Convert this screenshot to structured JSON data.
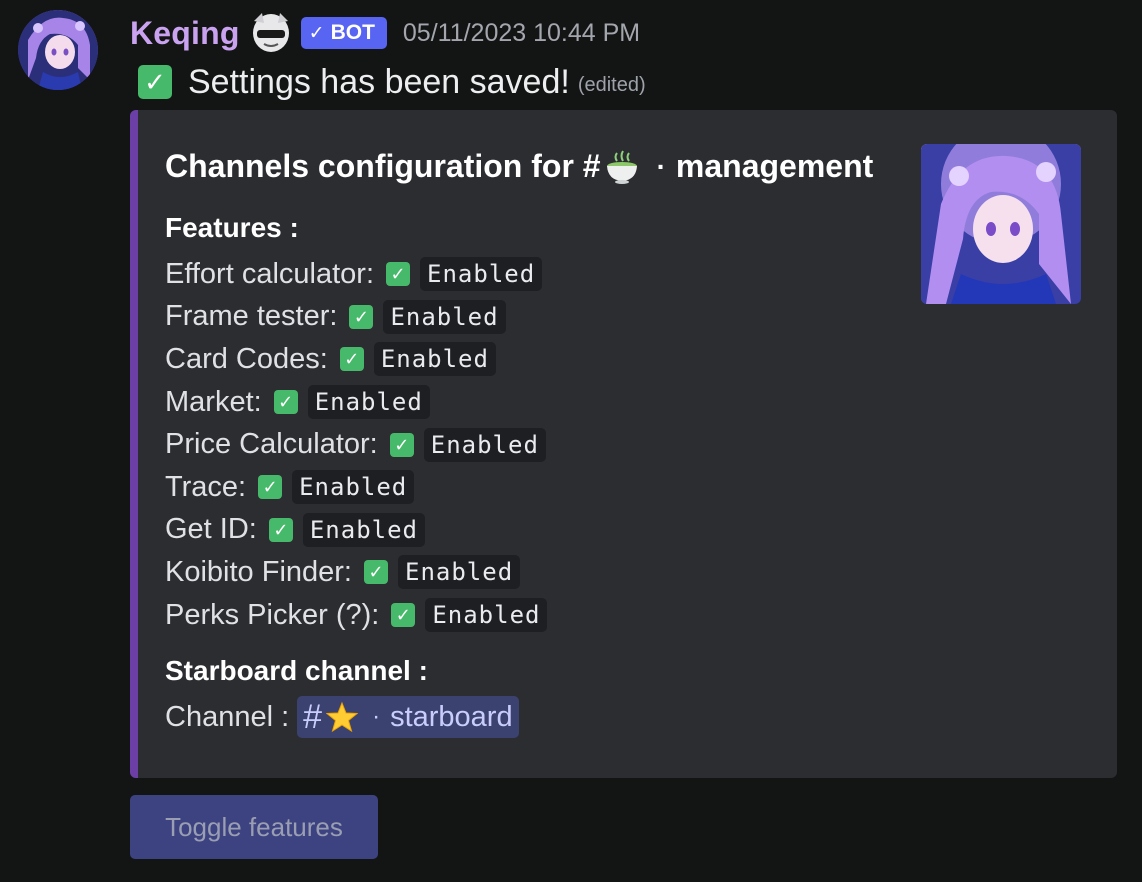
{
  "message": {
    "author": "Keqing",
    "bot_tag": "BOT",
    "bot_tag_icon": "checkmark-icon",
    "timestamp": "05/11/2023 10:44 PM",
    "content_text": "Settings has been saved!",
    "edited_label": "(edited)"
  },
  "embed": {
    "accent_color": "#6b3fa6",
    "title_prefix": "Channels configuration for #",
    "title_emoji": "tea-icon",
    "title_dot": "·",
    "title_channel": "management",
    "features_heading": "Features :",
    "features": [
      {
        "label": "Effort calculator:",
        "status": "Enabled"
      },
      {
        "label": "Frame tester:",
        "status": "Enabled"
      },
      {
        "label": "Card Codes:",
        "status": "Enabled"
      },
      {
        "label": "Market:",
        "status": "Enabled"
      },
      {
        "label": "Price Calculator:",
        "status": "Enabled"
      },
      {
        "label": "Trace:",
        "status": "Enabled"
      },
      {
        "label": "Get ID:",
        "status": "Enabled"
      },
      {
        "label": "Koibito Finder:",
        "status": "Enabled"
      },
      {
        "label": "Perks Picker (?):",
        "status": "Enabled"
      }
    ],
    "starboard_heading": "Starboard channel :",
    "channel_label": "Channel :",
    "channel_mention": {
      "hash": "#",
      "emoji": "star-icon",
      "dot": "·",
      "name": "starboard"
    }
  },
  "buttons": {
    "toggle_label": "Toggle features"
  },
  "colors": {
    "username": "#c9a2f0",
    "bot_tag": "#5865f2",
    "check_green": "#47b96a",
    "mention_bg": "#3c4270",
    "button_bg": "#3c4380"
  }
}
